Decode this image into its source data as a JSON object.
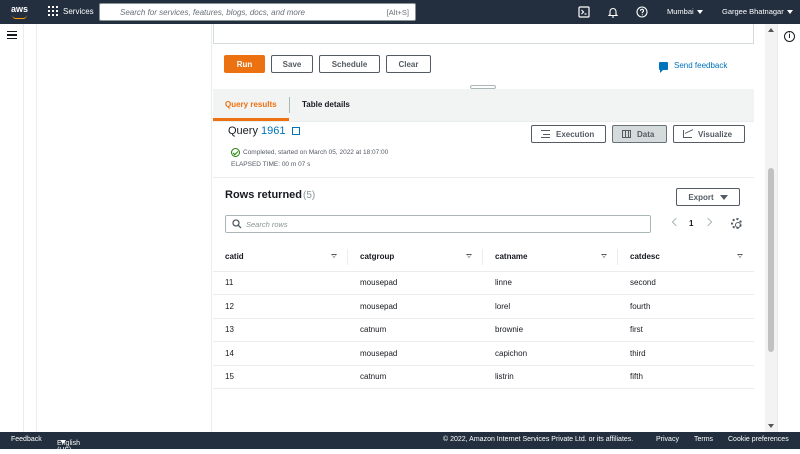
{
  "topnav": {
    "logo_text": "aws",
    "services_label": "Services",
    "search_placeholder": "Search for services, features, blogs, docs, and more",
    "search_shortcut": "[Alt+S]",
    "region": "Mumbai",
    "user": "Gargee Bhatnagar",
    "icons": [
      "cloudshell-icon",
      "bell-icon",
      "help-icon"
    ]
  },
  "editor": {
    "run_label": "Run",
    "save_label": "Save",
    "schedule_label": "Schedule",
    "clear_label": "Clear",
    "feedback_label": "Send feedback"
  },
  "results": {
    "tabs": [
      {
        "label": "Query results",
        "active": true
      },
      {
        "label": "Table details",
        "active": false
      }
    ],
    "query_prefix": "Query",
    "query_id": "1961",
    "status_text": "Completed, started on March 05, 2022 at 18:07:00",
    "elapsed_text": "ELAPSED TIME: 00 m 07 s",
    "view_buttons": [
      {
        "label": "Execution",
        "selected": false
      },
      {
        "label": "Data",
        "selected": true
      },
      {
        "label": "Visualize",
        "selected": false
      }
    ],
    "rows_title": "Rows returned",
    "rows_count": "(5)",
    "export_label": "Export",
    "row_search_placeholder": "Search rows",
    "page": "1"
  },
  "table": {
    "columns": [
      "catid",
      "catgroup",
      "catname",
      "catdesc"
    ],
    "rows": [
      [
        "11",
        "mousepad",
        "linne",
        "second"
      ],
      [
        "12",
        "mousepad",
        "lorel",
        "fourth"
      ],
      [
        "13",
        "catnum",
        "brownie",
        "first"
      ],
      [
        "14",
        "mousepad",
        "capichon",
        "third"
      ],
      [
        "15",
        "catnum",
        "listrin",
        "fifth"
      ]
    ]
  },
  "footer": {
    "feedback": "Feedback",
    "language": "English (US)",
    "copyright": "© 2022, Amazon Internet Services Private Ltd. or its affiliates.",
    "privacy": "Privacy",
    "terms": "Terms",
    "cookies": "Cookie preferences"
  },
  "colors": {
    "nav_bg": "#232f3e",
    "primary": "#ec7211",
    "link": "#0073bb",
    "success": "#1d8102"
  }
}
